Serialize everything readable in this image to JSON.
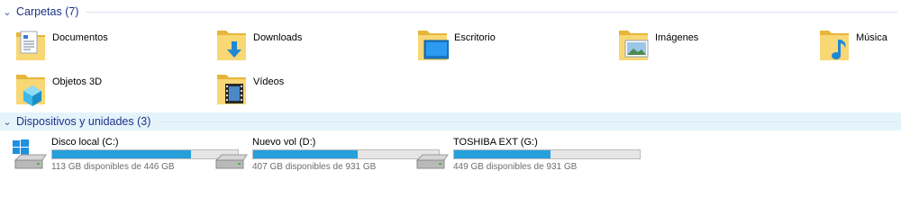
{
  "folders_group": {
    "title": "Carpetas (7)",
    "items": [
      {
        "label": "Documentos",
        "icon": "documents-folder-icon"
      },
      {
        "label": "Downloads",
        "icon": "downloads-folder-icon"
      },
      {
        "label": "Escritorio",
        "icon": "desktop-folder-icon"
      },
      {
        "label": "Imágenes",
        "icon": "pictures-folder-icon"
      },
      {
        "label": "Música",
        "icon": "music-folder-icon"
      },
      {
        "label": "Objetos 3D",
        "icon": "3d-objects-folder-icon"
      },
      {
        "label": "Vídeos",
        "icon": "videos-folder-icon"
      }
    ]
  },
  "devices_group": {
    "title": "Dispositivos y unidades (3)",
    "drives": [
      {
        "name": "Disco local (C:)",
        "free_text": "113 GB disponibles de 446 GB",
        "used_fraction": 0.747
      },
      {
        "name": "Nuevo vol (D:)",
        "free_text": "407 GB disponibles de 931 GB",
        "used_fraction": 0.563
      },
      {
        "name": "TOSHIBA EXT (G:)",
        "free_text": "449 GB disponibles de 931 GB",
        "used_fraction": 0.518
      }
    ]
  },
  "colors": {
    "header_text": "#1e3287",
    "usage_bar": "#26a0da",
    "folder_yellow": "#f8d775",
    "selected_group_bg": "#e5f3fb"
  }
}
